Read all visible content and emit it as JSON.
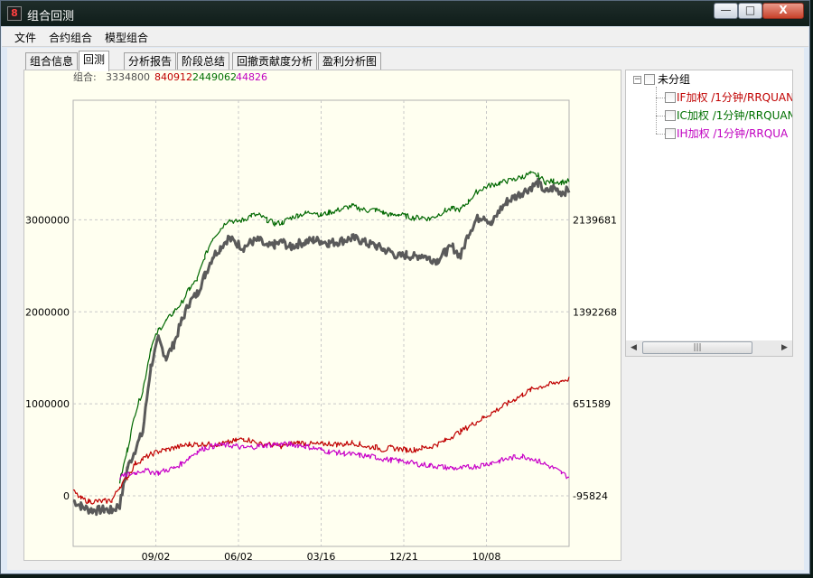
{
  "window": {
    "app_icon": "8",
    "title": "组合回测",
    "buttons": {
      "minimize": "—",
      "maximize": "□",
      "close": "X"
    }
  },
  "menu": [
    "文件",
    "合约组合",
    "模型组合"
  ],
  "tabs": [
    {
      "label": "组合信息",
      "active": false
    },
    {
      "label": "回测",
      "active": true
    },
    {
      "label": "分析报告",
      "active": false
    },
    {
      "label": "阶段总结",
      "active": false
    },
    {
      "label": "回撤贡献度分析",
      "active": false
    },
    {
      "label": "盈利分析图",
      "active": false
    }
  ],
  "chart_header": {
    "label": "组合:",
    "combo_value": "3334800",
    "values": [
      {
        "text": "840912",
        "color": "#c00000"
      },
      {
        "text": "2449062",
        "color": "#007000"
      },
      {
        "text": "44826",
        "color": "#c000c0"
      }
    ]
  },
  "tree": {
    "root": "未分组",
    "items": [
      {
        "label": "IF加权  /1分钟/RRQUAN",
        "color": "#c00000"
      },
      {
        "label": "IC加权  /1分钟/RRQUAN",
        "color": "#007000"
      },
      {
        "label": "IH加权  /1分钟/RRQUA",
        "color": "#c000c0"
      }
    ],
    "scroll_thumb_glyph": "|||"
  },
  "chart_data": {
    "type": "line",
    "x_tick_labels": [
      "09/02",
      "06/02",
      "03/16",
      "12/21",
      "10/08"
    ],
    "left_axis": {
      "ticks": [
        0,
        1000000,
        2000000,
        3000000
      ],
      "labels": [
        "0",
        "1000000",
        "2000000",
        "3000000"
      ],
      "range": [
        -550000,
        4300000
      ]
    },
    "right_axis": {
      "labels": [
        "-95824",
        "651589",
        "1392268",
        "2139681"
      ]
    },
    "grid": true,
    "series": [
      {
        "color": "#5a5a5a",
        "width": 3.0,
        "values": [
          -50000,
          -110000,
          -150000,
          -160000,
          -150000,
          -160000,
          -100000,
          300000,
          500000,
          700000,
          1400000,
          1700000,
          1500000,
          1650000,
          1900000,
          2100000,
          2200000,
          2400000,
          2600000,
          2700000,
          2800000,
          2750000,
          2700000,
          2760000,
          2780000,
          2700000,
          2730000,
          2760000,
          2700000,
          2740000,
          2760000,
          2780000,
          2770000,
          2750000,
          2760000,
          2780000,
          2800000,
          2780000,
          2740000,
          2720000,
          2680000,
          2650000,
          2600000,
          2620000,
          2600000,
          2620000,
          2580000,
          2560000,
          2650000,
          2700000,
          2600000,
          2850000,
          3000000,
          3050000,
          2950000,
          3100000,
          3200000,
          3250000,
          3300000,
          3350000,
          3400000,
          3300000,
          3350000,
          3300000,
          3320000
        ]
      },
      {
        "color": "#006800",
        "width": 1.2,
        "values": [
          null,
          null,
          null,
          null,
          null,
          null,
          150000,
          500000,
          900000,
          1150000,
          1600000,
          1800000,
          1900000,
          2000000,
          2100000,
          2250000,
          2350000,
          2600000,
          2800000,
          2900000,
          3000000,
          2980000,
          3000000,
          3050000,
          3050000,
          3000000,
          2960000,
          2970000,
          3020000,
          3050000,
          3070000,
          3090000,
          3050000,
          3080000,
          3100000,
          3130000,
          3150000,
          3120000,
          3100000,
          3110000,
          3080000,
          3050000,
          3060000,
          3040000,
          3020000,
          3030000,
          3010000,
          3050000,
          3100000,
          3120000,
          3110000,
          3200000,
          3300000,
          3350000,
          3380000,
          3400000,
          3420000,
          3440000,
          3470000,
          3500000,
          3480000,
          3410000,
          3420000,
          3410000,
          3420000
        ]
      },
      {
        "color": "#c00000",
        "width": 1.2,
        "values": [
          50000,
          -30000,
          -60000,
          -60000,
          -60000,
          -50000,
          100000,
          200000,
          350000,
          400000,
          450000,
          480000,
          500000,
          520000,
          540000,
          560000,
          560000,
          560000,
          560000,
          560000,
          580000,
          600000,
          620000,
          600000,
          560000,
          560000,
          550000,
          540000,
          560000,
          580000,
          570000,
          560000,
          560000,
          570000,
          560000,
          560000,
          580000,
          560000,
          530000,
          530000,
          500000,
          520000,
          510000,
          500000,
          500000,
          520000,
          530000,
          560000,
          600000,
          650000,
          700000,
          750000,
          800000,
          850000,
          900000,
          950000,
          1000000,
          1050000,
          1100000,
          1150000,
          1180000,
          1200000,
          1220000,
          1250000,
          1270000
        ]
      },
      {
        "color": "#c800c8",
        "width": 1.2,
        "values": [
          null,
          null,
          null,
          null,
          null,
          null,
          200000,
          230000,
          250000,
          280000,
          260000,
          250000,
          280000,
          300000,
          350000,
          420000,
          480000,
          520000,
          540000,
          550000,
          550000,
          540000,
          520000,
          530000,
          540000,
          550000,
          560000,
          560000,
          560000,
          550000,
          540000,
          520000,
          500000,
          480000,
          470000,
          460000,
          450000,
          440000,
          430000,
          420000,
          400000,
          390000,
          380000,
          370000,
          350000,
          340000,
          330000,
          320000,
          310000,
          300000,
          300000,
          310000,
          320000,
          340000,
          360000,
          380000,
          400000,
          420000,
          430000,
          410000,
          380000,
          340000,
          300000,
          250000,
          200000
        ]
      }
    ]
  }
}
